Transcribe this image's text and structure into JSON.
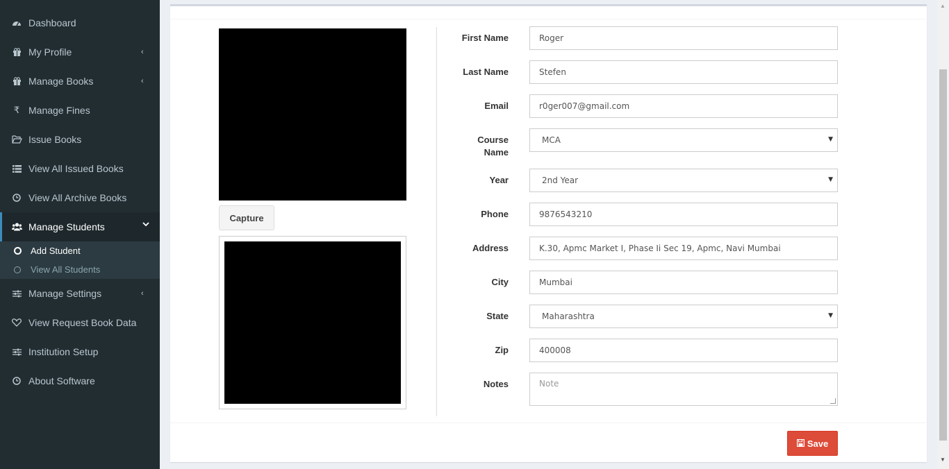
{
  "sidebar": {
    "items": [
      {
        "label": "Dashboard",
        "icon": "dashboard-icon",
        "has_chevron": false
      },
      {
        "label": "My Profile",
        "icon": "gift-icon",
        "has_chevron": true
      },
      {
        "label": "Manage Books",
        "icon": "gift-icon",
        "has_chevron": true
      },
      {
        "label": "Manage Fines",
        "icon": "rupee-icon",
        "has_chevron": false
      },
      {
        "label": "Issue Books",
        "icon": "folder-open-icon",
        "has_chevron": false
      },
      {
        "label": "View All Issued Books",
        "icon": "list-icon",
        "has_chevron": false
      },
      {
        "label": "View All Archive Books",
        "icon": "clock-icon",
        "has_chevron": false
      },
      {
        "label": "Manage Students",
        "icon": "users-icon",
        "has_chevron": true,
        "active": true
      },
      {
        "label": "Manage Settings",
        "icon": "sliders-icon",
        "has_chevron": true
      },
      {
        "label": "View Request Book Data",
        "icon": "heart-icon",
        "has_chevron": false
      },
      {
        "label": "Institution Setup",
        "icon": "sliders-icon",
        "has_chevron": false
      },
      {
        "label": "About Software",
        "icon": "clock-icon",
        "has_chevron": false
      }
    ],
    "subitems": [
      {
        "label": "Add Student",
        "current": true
      },
      {
        "label": "View All Students",
        "current": false
      }
    ],
    "chevron_left": "‹",
    "chevron_down": "⌄"
  },
  "form": {
    "capture_label": "Capture",
    "save_label": "Save",
    "fields": {
      "first_name": {
        "label": "First Name",
        "value": "Roger"
      },
      "last_name": {
        "label": "Last Name",
        "value": "Stefen"
      },
      "email": {
        "label": "Email",
        "value": "r0ger007@gmail.com"
      },
      "course": {
        "label_line1": "Course",
        "label_line2": "Name",
        "value": "MCA"
      },
      "year": {
        "label": "Year",
        "value": "2nd Year"
      },
      "phone": {
        "label": "Phone",
        "value": "9876543210"
      },
      "address": {
        "label": "Address",
        "value": "K.30, Apmc Market I, Phase Ii Sec 19, Apmc, Navi Mumbai"
      },
      "city": {
        "label": "City",
        "value": "Mumbai"
      },
      "state": {
        "label": "State",
        "value": "Maharashtra"
      },
      "zip": {
        "label": "Zip",
        "value": "400008"
      },
      "notes": {
        "label": "Notes",
        "placeholder": "Note"
      }
    }
  },
  "colors": {
    "sidebar_bg": "#222d32",
    "sidebar_active_bg": "#1e282c",
    "save_button": "#dd4b39"
  }
}
